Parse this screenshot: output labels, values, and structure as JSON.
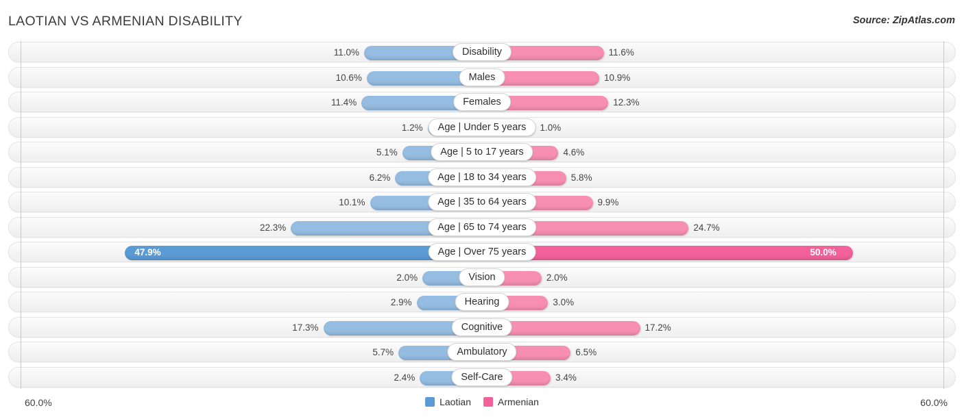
{
  "header": {
    "title": "LAOTIAN VS ARMENIAN DISABILITY",
    "source": "Source: ZipAtlas.com"
  },
  "footer": {
    "axis_left": "60.0%",
    "axis_right": "60.0%",
    "legend": [
      {
        "label": "Laotian",
        "color": "#5b9bd5"
      },
      {
        "label": "Armenian",
        "color": "#f2619a"
      }
    ]
  },
  "colors": {
    "laotian_normal": "#95bde2",
    "laotian_highlight": "#5b9bd5",
    "armenian_normal": "#f78fb3",
    "armenian_highlight": "#f2619a",
    "track": "#f4f4f4",
    "axis": "#c9c9c9"
  },
  "chart_data": {
    "type": "bar",
    "subtype": "diverging-bidirectional",
    "title": "LAOTIAN VS ARMENIAN DISABILITY",
    "xlabel": "",
    "ylabel": "",
    "xlim": [
      0,
      60
    ],
    "axis_max": 60.0,
    "axis_max_label": "60.0%",
    "grid": false,
    "legend_position": "bottom-center",
    "categories": [
      "Disability",
      "Males",
      "Females",
      "Age | Under 5 years",
      "Age | 5 to 17 years",
      "Age | 18 to 34 years",
      "Age | 35 to 64 years",
      "Age | 65 to 74 years",
      "Age | Over 75 years",
      "Vision",
      "Hearing",
      "Cognitive",
      "Ambulatory",
      "Self-Care"
    ],
    "series": [
      {
        "name": "Laotian",
        "color": "#95bde2",
        "values": [
          11.0,
          10.6,
          11.4,
          1.2,
          5.1,
          6.2,
          10.1,
          22.3,
          47.9,
          2.0,
          2.9,
          17.3,
          5.7,
          2.4
        ],
        "labels": [
          "11.0%",
          "10.6%",
          "11.4%",
          "1.2%",
          "5.1%",
          "6.2%",
          "10.1%",
          "22.3%",
          "47.9%",
          "2.0%",
          "2.9%",
          "17.3%",
          "5.7%",
          "2.4%"
        ]
      },
      {
        "name": "Armenian",
        "color": "#f78fb3",
        "values": [
          11.6,
          10.9,
          12.3,
          1.0,
          4.6,
          5.8,
          9.9,
          24.7,
          50.0,
          2.0,
          3.0,
          17.2,
          6.5,
          3.4
        ],
        "labels": [
          "11.6%",
          "10.9%",
          "12.3%",
          "1.0%",
          "4.6%",
          "5.8%",
          "9.9%",
          "24.7%",
          "50.0%",
          "2.0%",
          "3.0%",
          "17.2%",
          "6.5%",
          "3.4%"
        ]
      }
    ],
    "highlight_row_index": 8
  },
  "rows": [
    {
      "label": "Disability",
      "left_value": 11.0,
      "left_label": "11.0%",
      "right_value": 11.6,
      "right_label": "11.6%",
      "highlight": false
    },
    {
      "label": "Males",
      "left_value": 10.6,
      "left_label": "10.6%",
      "right_value": 10.9,
      "right_label": "10.9%",
      "highlight": false
    },
    {
      "label": "Females",
      "left_value": 11.4,
      "left_label": "11.4%",
      "right_value": 12.3,
      "right_label": "12.3%",
      "highlight": false
    },
    {
      "label": "Age | Under 5 years",
      "left_value": 1.2,
      "left_label": "1.2%",
      "right_value": 1.0,
      "right_label": "1.0%",
      "highlight": false
    },
    {
      "label": "Age | 5 to 17 years",
      "left_value": 5.1,
      "left_label": "5.1%",
      "right_value": 4.6,
      "right_label": "4.6%",
      "highlight": false
    },
    {
      "label": "Age | 18 to 34 years",
      "left_value": 6.2,
      "left_label": "6.2%",
      "right_value": 5.8,
      "right_label": "5.8%",
      "highlight": false
    },
    {
      "label": "Age | 35 to 64 years",
      "left_value": 10.1,
      "left_label": "10.1%",
      "right_value": 9.9,
      "right_label": "9.9%",
      "highlight": false
    },
    {
      "label": "Age | 65 to 74 years",
      "left_value": 22.3,
      "left_label": "22.3%",
      "right_value": 24.7,
      "right_label": "24.7%",
      "highlight": false
    },
    {
      "label": "Age | Over 75 years",
      "left_value": 47.9,
      "left_label": "47.9%",
      "right_value": 50.0,
      "right_label": "50.0%",
      "highlight": true
    },
    {
      "label": "Vision",
      "left_value": 2.0,
      "left_label": "2.0%",
      "right_value": 2.0,
      "right_label": "2.0%",
      "highlight": false
    },
    {
      "label": "Hearing",
      "left_value": 2.9,
      "left_label": "2.9%",
      "right_value": 3.0,
      "right_label": "3.0%",
      "highlight": false
    },
    {
      "label": "Cognitive",
      "left_value": 17.3,
      "left_label": "17.3%",
      "right_value": 17.2,
      "right_label": "17.2%",
      "highlight": false
    },
    {
      "label": "Ambulatory",
      "left_value": 5.7,
      "left_label": "5.7%",
      "right_value": 6.5,
      "right_label": "6.5%",
      "highlight": false
    },
    {
      "label": "Self-Care",
      "left_value": 2.4,
      "left_label": "2.4%",
      "right_value": 3.4,
      "right_label": "3.4%",
      "highlight": false
    }
  ]
}
